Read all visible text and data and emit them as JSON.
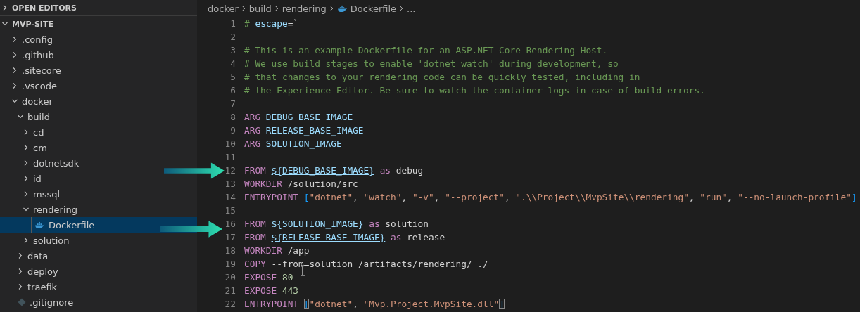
{
  "sidebar": {
    "sections": [
      {
        "title": "OPEN EDITORS",
        "expanded": false
      },
      {
        "title": "MVP-SITE",
        "expanded": true
      }
    ],
    "tree": [
      {
        "name": ".config",
        "kind": "folder",
        "expanded": false,
        "selected": false
      },
      {
        "name": ".github",
        "kind": "folder",
        "expanded": false,
        "selected": false
      },
      {
        "name": ".sitecore",
        "kind": "folder",
        "expanded": false,
        "selected": false
      },
      {
        "name": ".vscode",
        "kind": "folder",
        "expanded": false,
        "selected": false
      },
      {
        "name": "docker",
        "kind": "folder",
        "expanded": true,
        "selected": false,
        "children": [
          {
            "name": "build",
            "kind": "folder",
            "expanded": true,
            "selected": false,
            "children": [
              {
                "name": "cd",
                "kind": "folder",
                "expanded": false,
                "selected": false
              },
              {
                "name": "cm",
                "kind": "folder",
                "expanded": false,
                "selected": false
              },
              {
                "name": "dotnetsdk",
                "kind": "folder",
                "expanded": false,
                "selected": false
              },
              {
                "name": "id",
                "kind": "folder",
                "expanded": false,
                "selected": false
              },
              {
                "name": "mssql",
                "kind": "folder",
                "expanded": false,
                "selected": false
              },
              {
                "name": "rendering",
                "kind": "folder",
                "expanded": true,
                "selected": false,
                "children": [
                  {
                    "name": "Dockerfile",
                    "kind": "docker_file",
                    "selected": true
                  }
                ]
              },
              {
                "name": "solution",
                "kind": "folder",
                "expanded": false,
                "selected": false
              }
            ]
          },
          {
            "name": "data",
            "kind": "folder",
            "expanded": false,
            "selected": false
          },
          {
            "name": "deploy",
            "kind": "folder",
            "expanded": false,
            "selected": false
          },
          {
            "name": "traefik",
            "kind": "folder",
            "expanded": false,
            "selected": false
          }
        ]
      },
      {
        "name": ".gitignore",
        "kind": "git_file",
        "selected": false
      }
    ]
  },
  "breadcrumb": [
    {
      "text": "docker",
      "kind": "folder"
    },
    {
      "text": "build",
      "kind": "folder"
    },
    {
      "text": "rendering",
      "kind": "folder"
    },
    {
      "text": "Dockerfile",
      "kind": "docker_file"
    },
    {
      "text": "...",
      "kind": "more"
    }
  ],
  "editor": {
    "lines": [
      {
        "number": "1",
        "tokens": [
          {
            "kind": "comment",
            "text": "#"
          },
          {
            "kind": "variable",
            "text": "escape",
            "space": true
          },
          {
            "kind": "plain",
            "text": "=`"
          }
        ]
      },
      {
        "number": "2"
      },
      {
        "number": "3",
        "tokens": [
          {
            "kind": "comment",
            "text": "# This is an example Dockerfile for an ASP.NET Core Rendering Host."
          }
        ]
      },
      {
        "number": "4",
        "tokens": [
          {
            "kind": "comment",
            "text": "# We use build stages to enable 'dotnet watch' during development, so"
          }
        ]
      },
      {
        "number": "5",
        "tokens": [
          {
            "kind": "comment",
            "text": "# that changes to your rendering code can be quickly tested, including in"
          }
        ]
      },
      {
        "number": "6",
        "tokens": [
          {
            "kind": "comment",
            "text": "# the Experience Editor. Be sure to watch the container logs in case of build errors."
          }
        ]
      },
      {
        "number": "7"
      },
      {
        "number": "8",
        "tokens": [
          {
            "kind": "keyword",
            "text": "ARG"
          },
          {
            "kind": "variable",
            "text": "DEBUG_BASE_IMAGE",
            "space": true
          }
        ]
      },
      {
        "number": "9",
        "tokens": [
          {
            "kind": "keyword",
            "text": "ARG"
          },
          {
            "kind": "variable",
            "text": "RELEASE_BASE_IMAGE",
            "space": true
          }
        ]
      },
      {
        "number": "10",
        "tokens": [
          {
            "kind": "keyword",
            "text": "ARG"
          },
          {
            "kind": "variable",
            "text": "SOLUTION_IMAGE",
            "space": true
          }
        ]
      },
      {
        "number": "11"
      },
      {
        "number": "12",
        "tokens": [
          {
            "kind": "keyword",
            "text": "FROM"
          },
          {
            "kind": "link",
            "text": "${DEBUG_BASE_IMAGE}",
            "space": true
          },
          {
            "kind": "keyword",
            "text": "as",
            "space": true
          },
          {
            "kind": "plain",
            "text": "debug",
            "space": true
          }
        ]
      },
      {
        "number": "13",
        "tokens": [
          {
            "kind": "keyword",
            "text": "WORKDIR"
          },
          {
            "kind": "plain",
            "text": "/solution/src",
            "space": true
          }
        ]
      },
      {
        "number": "14",
        "tokens": [
          {
            "kind": "keyword",
            "text": "ENTRYPOINT"
          },
          {
            "kind": "bracket",
            "text": "[",
            "space": true
          },
          {
            "kind": "string",
            "text": "\"dotnet\""
          },
          {
            "kind": "plain",
            "text": ","
          },
          {
            "kind": "string",
            "text": "\"watch\"",
            "space": true
          },
          {
            "kind": "plain",
            "text": ","
          },
          {
            "kind": "string",
            "text": "\"-v\"",
            "space": true
          },
          {
            "kind": "plain",
            "text": ","
          },
          {
            "kind": "string",
            "text": "\"--project\"",
            "space": true
          },
          {
            "kind": "plain",
            "text": ","
          },
          {
            "kind": "string",
            "text": "\".\\\\Project\\\\MvpSite\\\\rendering\"",
            "space": true
          },
          {
            "kind": "plain",
            "text": ","
          },
          {
            "kind": "string",
            "text": "\"run\"",
            "space": true
          },
          {
            "kind": "plain",
            "text": ","
          },
          {
            "kind": "string",
            "text": "\"--no-launch-profile\"",
            "space": true
          },
          {
            "kind": "bracket",
            "text": "]"
          }
        ]
      },
      {
        "number": "15"
      },
      {
        "number": "16",
        "tokens": [
          {
            "kind": "keyword",
            "text": "FROM"
          },
          {
            "kind": "link",
            "text": "${SOLUTION_IMAGE}",
            "space": true
          },
          {
            "kind": "keyword",
            "text": "as",
            "space": true
          },
          {
            "kind": "plain",
            "text": "solution",
            "space": true
          }
        ]
      },
      {
        "number": "17",
        "tokens": [
          {
            "kind": "keyword",
            "text": "FROM"
          },
          {
            "kind": "link",
            "text": "${RELEASE_BASE_IMAGE}",
            "space": true
          },
          {
            "kind": "keyword",
            "text": "as",
            "space": true
          },
          {
            "kind": "plain",
            "text": "release",
            "space": true
          }
        ]
      },
      {
        "number": "18",
        "tokens": [
          {
            "kind": "keyword",
            "text": "WORKDIR"
          },
          {
            "kind": "plain",
            "text": "/app",
            "space": true
          }
        ]
      },
      {
        "number": "19",
        "tokens": [
          {
            "kind": "keyword",
            "text": "COPY"
          },
          {
            "kind": "plain",
            "text": "--from=solution /artifacts/rendering/ ./",
            "space": true
          }
        ]
      },
      {
        "number": "20",
        "tokens": [
          {
            "kind": "keyword",
            "text": "EXPOSE"
          },
          {
            "kind": "number",
            "text": "80",
            "space": true
          }
        ]
      },
      {
        "number": "21",
        "tokens": [
          {
            "kind": "keyword",
            "text": "EXPOSE"
          },
          {
            "kind": "number",
            "text": "443",
            "space": true
          }
        ]
      },
      {
        "number": "22",
        "tokens": [
          {
            "kind": "keyword",
            "text": "ENTRYPOINT"
          },
          {
            "kind": "bracket_match",
            "text": "[",
            "space": true
          },
          {
            "kind": "string",
            "text": "\"dotnet\""
          },
          {
            "kind": "plain",
            "text": ","
          },
          {
            "kind": "string",
            "text": "\"Mvp.Project.MvpSite.dll\"",
            "space": true
          },
          {
            "kind": "bracket_match",
            "text": "]"
          }
        ]
      }
    ]
  }
}
